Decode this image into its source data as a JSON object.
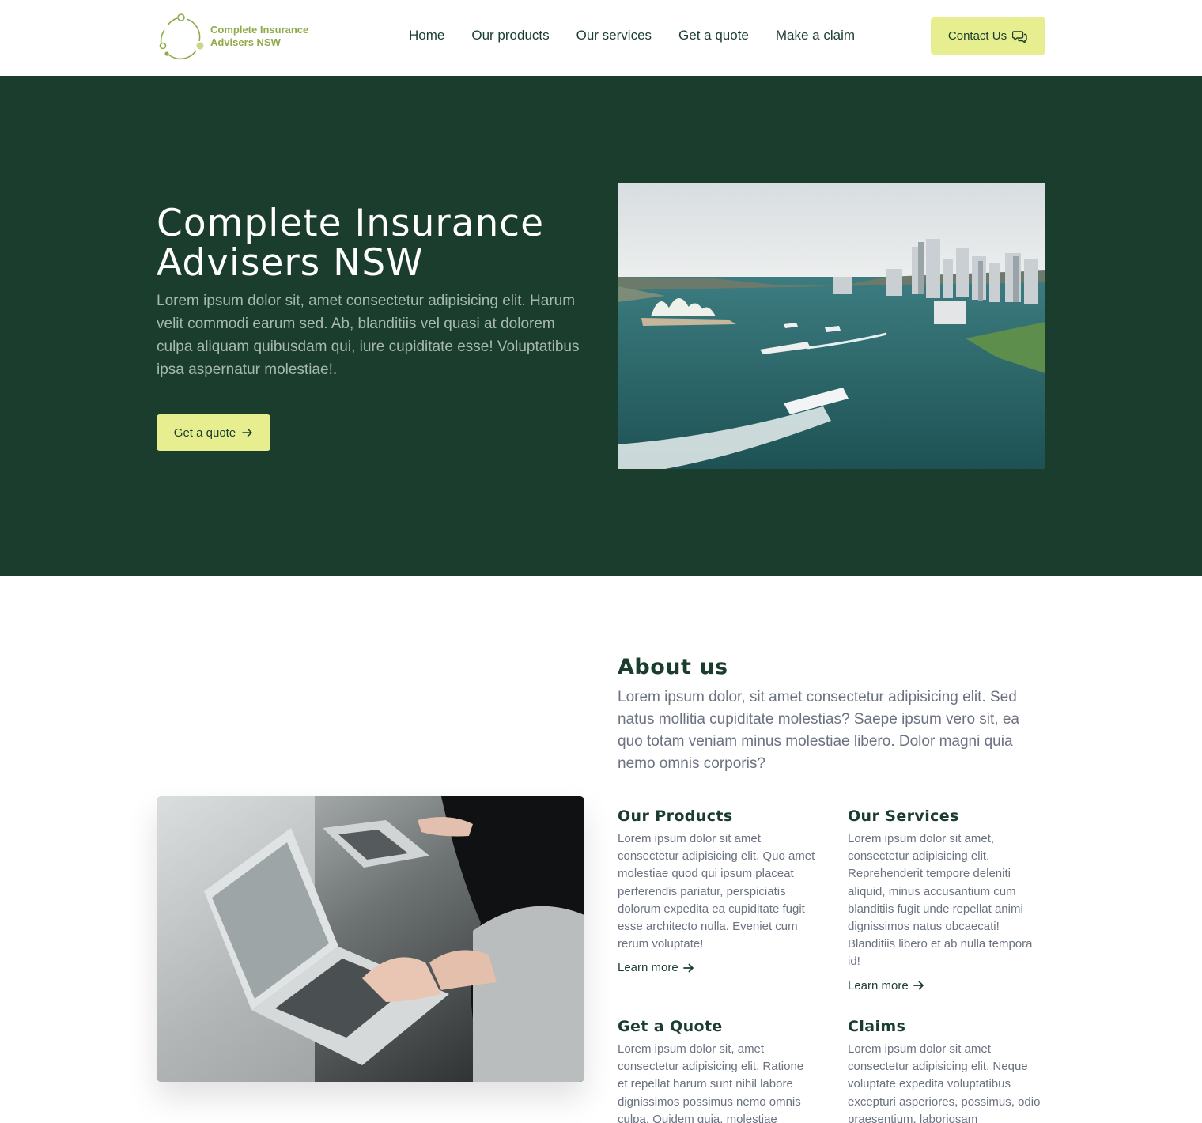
{
  "brand": {
    "line1": "Complete Insurance",
    "line2": "Advisers NSW"
  },
  "nav": [
    "Home",
    "Our products",
    "Our services",
    "Get a quote",
    "Make a claim"
  ],
  "contact_label": "Contact Us",
  "hero": {
    "title_line1": "Complete Insurance",
    "title_line2": "Advisers NSW",
    "text": "Lorem ipsum dolor sit, amet consectetur adipisicing elit. Harum velit commodi earum sed. Ab, blanditiis vel quasi at dolorem culpa aliquam quibusdam qui, iure cupiditate esse! Voluptatibus ipsa aspernatur molestiae!.",
    "cta": "Get a quote"
  },
  "about": {
    "title": "About us",
    "text": "Lorem ipsum dolor, sit amet consectetur adipisicing elit. Sed natus mollitia cupiditate molestias? Saepe ipsum vero sit, ea quo totam veniam minus molestiae libero. Dolor magni quia nemo omnis corporis?"
  },
  "cards": [
    {
      "title": "Our Products",
      "text": "Lorem ipsum dolor sit amet consectetur adipisicing elit. Quo amet molestiae quod qui ipsum placeat perferendis pariatur, perspiciatis dolorum expedita ea cupiditate fugit esse architecto nulla. Eveniet cum rerum voluptate!",
      "link": "Learn more"
    },
    {
      "title": "Our Services",
      "text": "Lorem ipsum dolor sit amet, consectetur adipisicing elit. Reprehenderit tempore deleniti aliquid, minus accusantium cum blanditiis fugit unde repellat animi dignissimos natus obcaecati! Blanditiis libero et ab nulla tempora id!",
      "link": "Learn more"
    },
    {
      "title": "Get a Quote",
      "text": "Lorem ipsum dolor sit, amet consectetur adipisicing elit. Ratione et repellat harum sunt nihil labore dignissimos possimus nemo omnis culpa. Quidem quia, molestiae"
    },
    {
      "title": "Claims",
      "text": "Lorem ipsum dolor sit amet consectetur adipisicing elit. Neque voluptate expedita voluptatibus excepturi asperiores, possimus, odio praesentium, laboriosam"
    }
  ],
  "colors": {
    "primary": "#1a3d2e",
    "accent": "#e6ee8f",
    "logo": "#8faa4a"
  },
  "icons": [
    "logo-icon",
    "chat-icon",
    "arrow-right-icon"
  ]
}
